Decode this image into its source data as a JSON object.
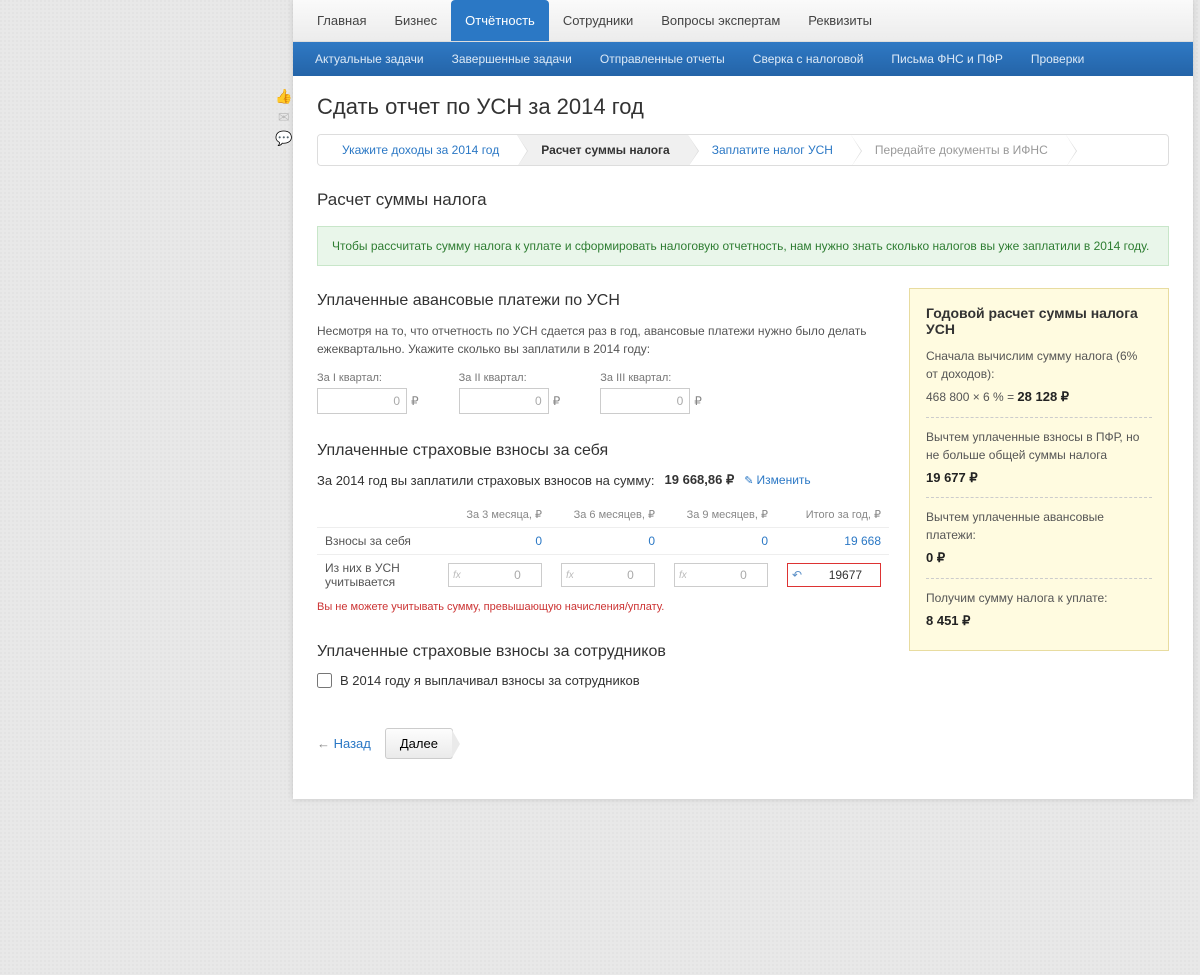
{
  "topnav": {
    "items": [
      "Главная",
      "Бизнес",
      "Отчётность",
      "Сотрудники",
      "Вопросы экспертам",
      "Реквизиты"
    ],
    "active_index": 2
  },
  "subnav": {
    "items": [
      "Актуальные задачи",
      "Завершенные задачи",
      "Отправленные отчеты",
      "Сверка с налоговой",
      "Письма ФНС и ПФР",
      "Проверки"
    ]
  },
  "page_title": "Сдать отчет по УСН за 2014 год",
  "steps": {
    "items": [
      "Укажите доходы за 2014 год",
      "Расчет суммы налога",
      "Заплатите налог УСН",
      "Передайте документы в ИФНС"
    ],
    "active_index": 1
  },
  "section_heading": "Расчет суммы налога",
  "info_banner": "Чтобы рассчитать сумму налога к уплате и сформировать налоговую отчетность, нам нужно знать сколько налогов вы уже заплатили в 2014 году.",
  "advance": {
    "heading": "Уплаченные авансовые платежи по УСН",
    "hint": "Несмотря на то, что отчетность по УСН сдается раз в год, авансовые платежи нужно было делать ежеквартально. Укажите сколько вы заплатили в 2014 году:",
    "q1_label": "За I квартал:",
    "q2_label": "За II квартал:",
    "q3_label": "За III квартал:",
    "q1_value": "0",
    "q2_value": "0",
    "q3_value": "0",
    "currency": "₽"
  },
  "insurance": {
    "heading": "Уплаченные страховые взносы за себя",
    "paid_line_prefix": "За 2014 год вы заплатили страховых взносов на сумму:",
    "paid_amount": "19 668,86 ₽",
    "change_label": "Изменить",
    "cols": [
      "",
      "За 3 месяца, ₽",
      "За 6 месяцев, ₽",
      "За 9 месяцев, ₽",
      "Итого за год, ₽"
    ],
    "row1_label": "Взносы за себя",
    "row1_vals": [
      "0",
      "0",
      "0",
      "19 668"
    ],
    "row2_label": "Из них в УСН учитывается",
    "row2_vals": [
      "0",
      "0",
      "0",
      "19677"
    ],
    "error_text": "Вы не можете учитывать сумму, превышающую начисления/уплату."
  },
  "employees": {
    "heading": "Уплаченные страховые взносы за сотрудников",
    "checkbox_label": "В 2014 году я выплачивал взносы за сотрудников"
  },
  "navb": {
    "back": "Назад",
    "next": "Далее"
  },
  "sidebar": {
    "title": "Годовой расчет суммы налога УСН",
    "line1": "Сначала вычислим сумму налога (6% от доходов):",
    "formula": "468 800 × 6 % = ",
    "formula_result": "28 128 ₽",
    "line2": "Вычтем уплаченные взносы в ПФР, но не больше общей суммы налога",
    "val2": "19 677 ₽",
    "line3": "Вычтем уплаченные авансовые платежи:",
    "val3": "0 ₽",
    "line4": "Получим сумму налога к уплате:",
    "val4": "8 451 ₽"
  }
}
